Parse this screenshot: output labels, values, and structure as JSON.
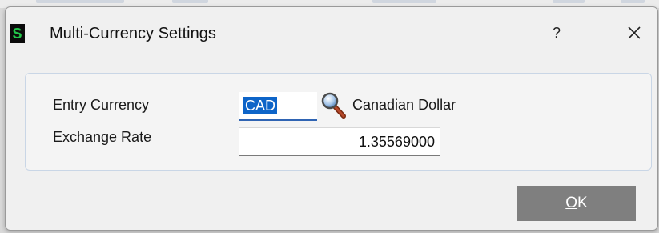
{
  "window": {
    "title": "Multi-Currency Settings",
    "logo_letter": "S",
    "help_label": "?",
    "logo_colors": {
      "background": "#0b0b0b",
      "foreground": "#22c84a"
    }
  },
  "form": {
    "entry_currency": {
      "label": "Entry Currency",
      "value": "CAD",
      "description": "Canadian Dollar",
      "lookup_icon": "magnifier-icon"
    },
    "exchange_rate": {
      "label": "Exchange Rate",
      "value": "1.35569000"
    }
  },
  "buttons": {
    "ok": {
      "accesskey": "O",
      "rest": "K"
    }
  },
  "colors": {
    "selection": "#0d64c8",
    "ok_button": "#7f7f7f",
    "panel_border": "#c9d6e6"
  }
}
